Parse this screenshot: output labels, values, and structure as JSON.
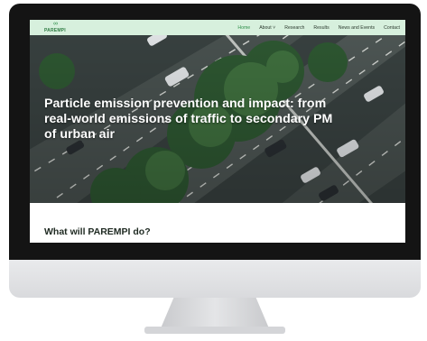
{
  "site": {
    "logo_text": "PAREMPI",
    "logo_mark": "∞"
  },
  "nav": {
    "items": [
      {
        "label": "Home",
        "active": true
      },
      {
        "label": "About ˅",
        "active": false
      },
      {
        "label": "Research",
        "active": false
      },
      {
        "label": "Results",
        "active": false
      },
      {
        "label": "News and Events",
        "active": false
      },
      {
        "label": "Contact",
        "active": false
      }
    ]
  },
  "hero": {
    "title_line1": "Particle emission prevention and impact: from",
    "title_line2": "real-world emissions of traffic to secondary PM",
    "title_line3": "of urban air"
  },
  "section": {
    "title": "What will PAREMPI do?"
  },
  "colors": {
    "navbar_bg": "#d7f0dd",
    "brand_green": "#2f8f4a"
  }
}
